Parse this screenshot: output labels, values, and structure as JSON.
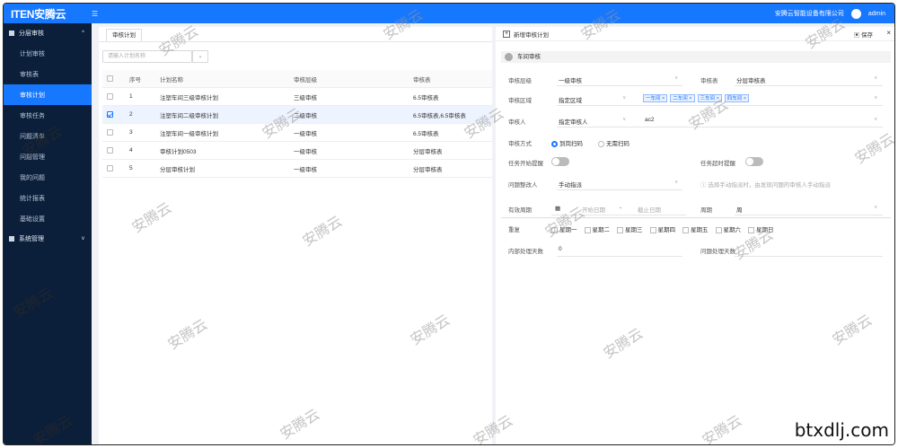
{
  "header": {
    "logo": "ITEN安腾云",
    "menu_icon": "menu-fold-icon",
    "org": "安腾云智能设备有限公司",
    "user": "admin"
  },
  "sidebar": {
    "group1": "分层审核",
    "items": [
      "计划审核",
      "审核表",
      "审核计划",
      "审核任务",
      "问题清单",
      "问题管理",
      "我的问题",
      "统计报表",
      "基础设置"
    ],
    "group2": "系统管理"
  },
  "left": {
    "tab": "审核计划",
    "search_placeholder": "请输入计划名称",
    "columns": [
      "序号",
      "计划名称",
      "审核层级",
      "审核表"
    ],
    "rows": [
      {
        "no": "1",
        "name": "注塑车间三级审核计划",
        "level": "三级审核",
        "table": "6.5审核表"
      },
      {
        "no": "2",
        "name": "注塑车间二级审核计划",
        "level": "二级审核",
        "table": "6.5审核表,6.5审核表"
      },
      {
        "no": "3",
        "name": "注塑车间一级审核计划",
        "level": "一级审核",
        "table": "6.5审核表"
      },
      {
        "no": "4",
        "name": "审核计划0503",
        "level": "一级审核",
        "table": "分层审核表"
      },
      {
        "no": "5",
        "name": "分层审核计划",
        "level": "一级审核",
        "table": "分层审核表"
      }
    ]
  },
  "right": {
    "title": "新增审核计划",
    "save": "保存",
    "section": "车间审核",
    "level_label": "审核层级",
    "level_value": "一级审核",
    "table_label": "审核表",
    "table_value": "分层审核表",
    "area_label": "审核区域",
    "area_value": "指定区域",
    "chips": [
      "一车间",
      "二车间",
      "三车间",
      "四车间"
    ],
    "auditor_label": "审核人",
    "auditor_value": "指定审核人",
    "auditor_name": "ac2",
    "method_label": "审核方式",
    "method_on": "到岗扫码",
    "method_off": "无需扫码",
    "remind_label": "任务开始提醒",
    "timeout_label": "任务超时提醒",
    "assign_label": "问题整改人",
    "assign_value": "手动指派",
    "assign_hint": "选择手动指派时，由发现问题的审核人手动指派",
    "period_label": "有效周期",
    "start_placeholder": "开始日期",
    "end_placeholder": "截止日期",
    "cycle_label": "周期",
    "cycle_value": "周",
    "repeat_label": "重复",
    "weekdays": [
      "星期一",
      "星期二",
      "星期三",
      "星期四",
      "星期五",
      "星期六",
      "星期日"
    ],
    "rule_label": "内部处理天数",
    "rule_value": "0",
    "remind2_label": "问题处理天数"
  },
  "watermark": "安腾云",
  "site": "btxdlj.com"
}
